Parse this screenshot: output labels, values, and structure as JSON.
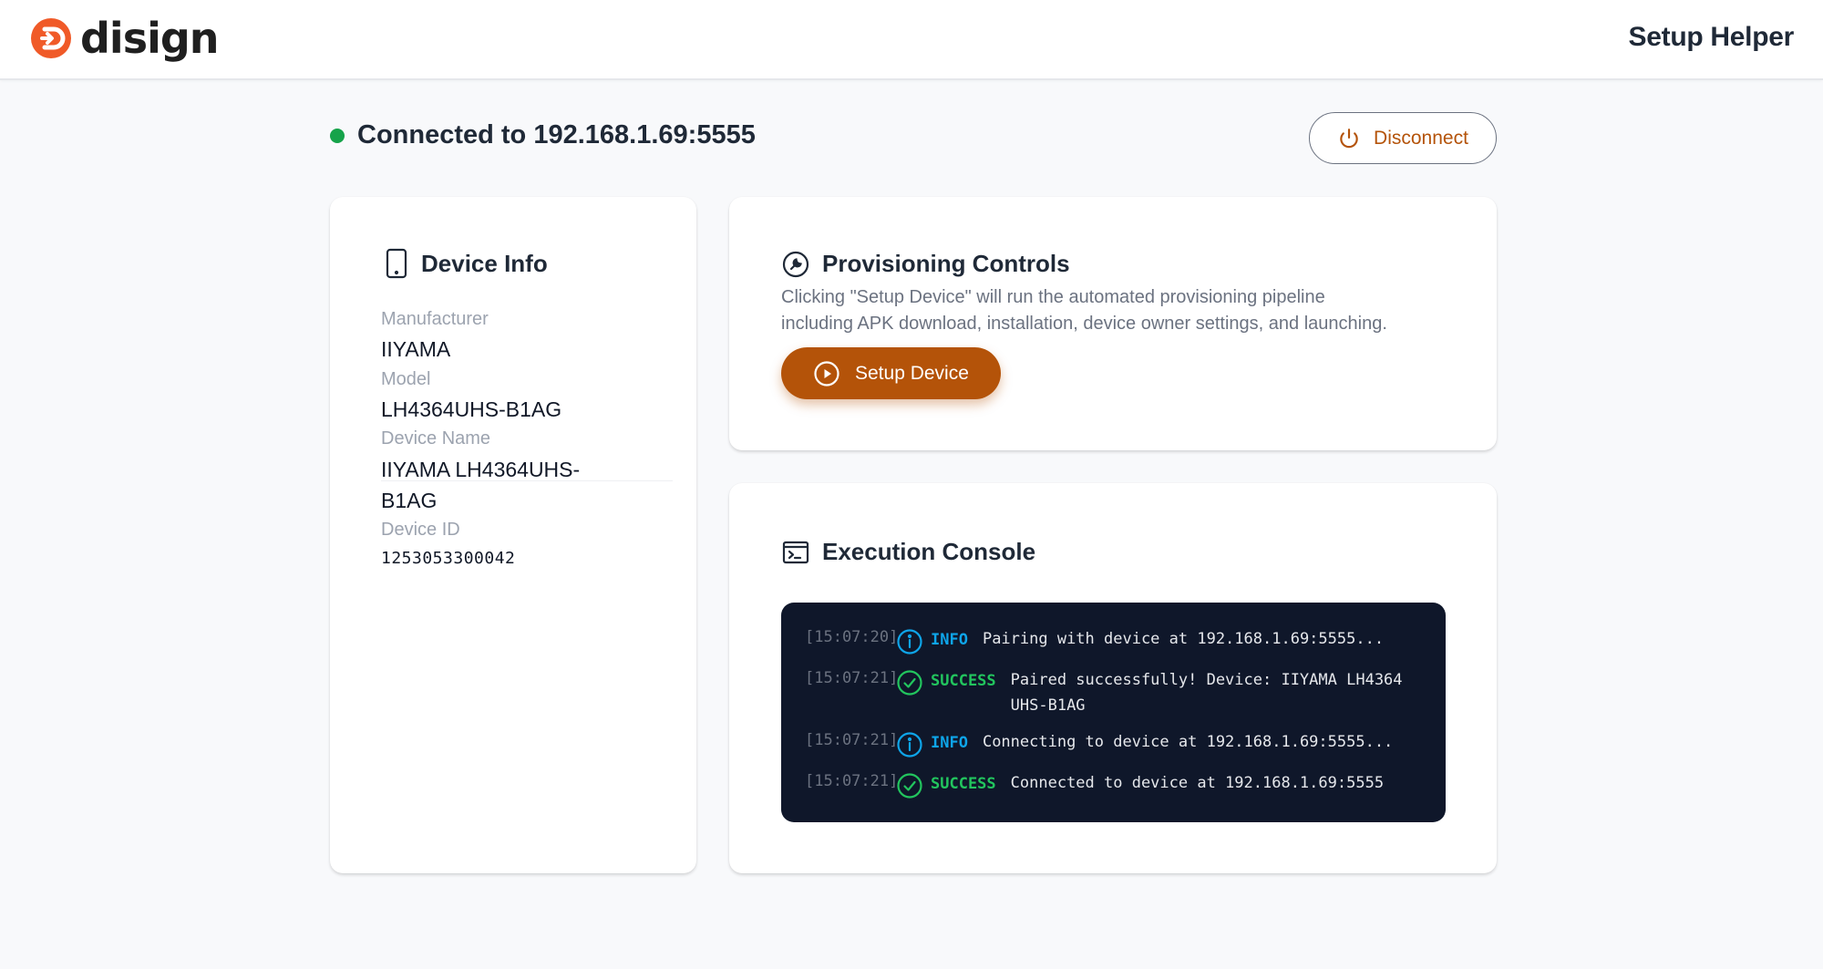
{
  "app": {
    "logo_text": "disign",
    "title": "Setup Helper"
  },
  "connection": {
    "status_text": "Connected to 192.168.1.69:5555",
    "status_color": "#16a34a",
    "disconnect_label": "Disconnect"
  },
  "device_info": {
    "title": "Device Info",
    "fields": [
      {
        "label": "Manufacturer",
        "value": "IIYAMA"
      },
      {
        "label": "Model",
        "value": "LH4364UHS-B1AG"
      },
      {
        "label": "Device Name",
        "value_line1": "IIYAMA LH4364UHS-",
        "value_line2": "B1AG"
      },
      {
        "label": "Device ID",
        "value": "1253053300042"
      }
    ]
  },
  "provisioning": {
    "title": "Provisioning Controls",
    "description_line1": "Clicking \"Setup Device\" will run the automated provisioning pipeline",
    "description_line2": "including APK download, installation, device owner settings, and launching.",
    "setup_label": "Setup Device",
    "accent_color": "#b45309"
  },
  "console": {
    "title": "Execution Console",
    "logs": [
      {
        "time": "[15:07:20]",
        "level": "INFO",
        "icon": "info-icon",
        "message": "Pairing with device at 192.168.1.69:5555..."
      },
      {
        "time": "[15:07:21]",
        "level": "SUCCESS",
        "icon": "check-circle-icon",
        "message_line1": "Paired successfully! Device: IIYAMA LH4364",
        "message_line2": "UHS-B1AG"
      },
      {
        "time": "[15:07:21]",
        "level": "INFO",
        "icon": "info-icon",
        "message": "Connecting to device at 192.168.1.69:5555..."
      },
      {
        "time": "[15:07:21]",
        "level": "SUCCESS",
        "icon": "check-circle-icon",
        "message": "Connected to device at 192.168.1.69:5555"
      }
    ]
  }
}
